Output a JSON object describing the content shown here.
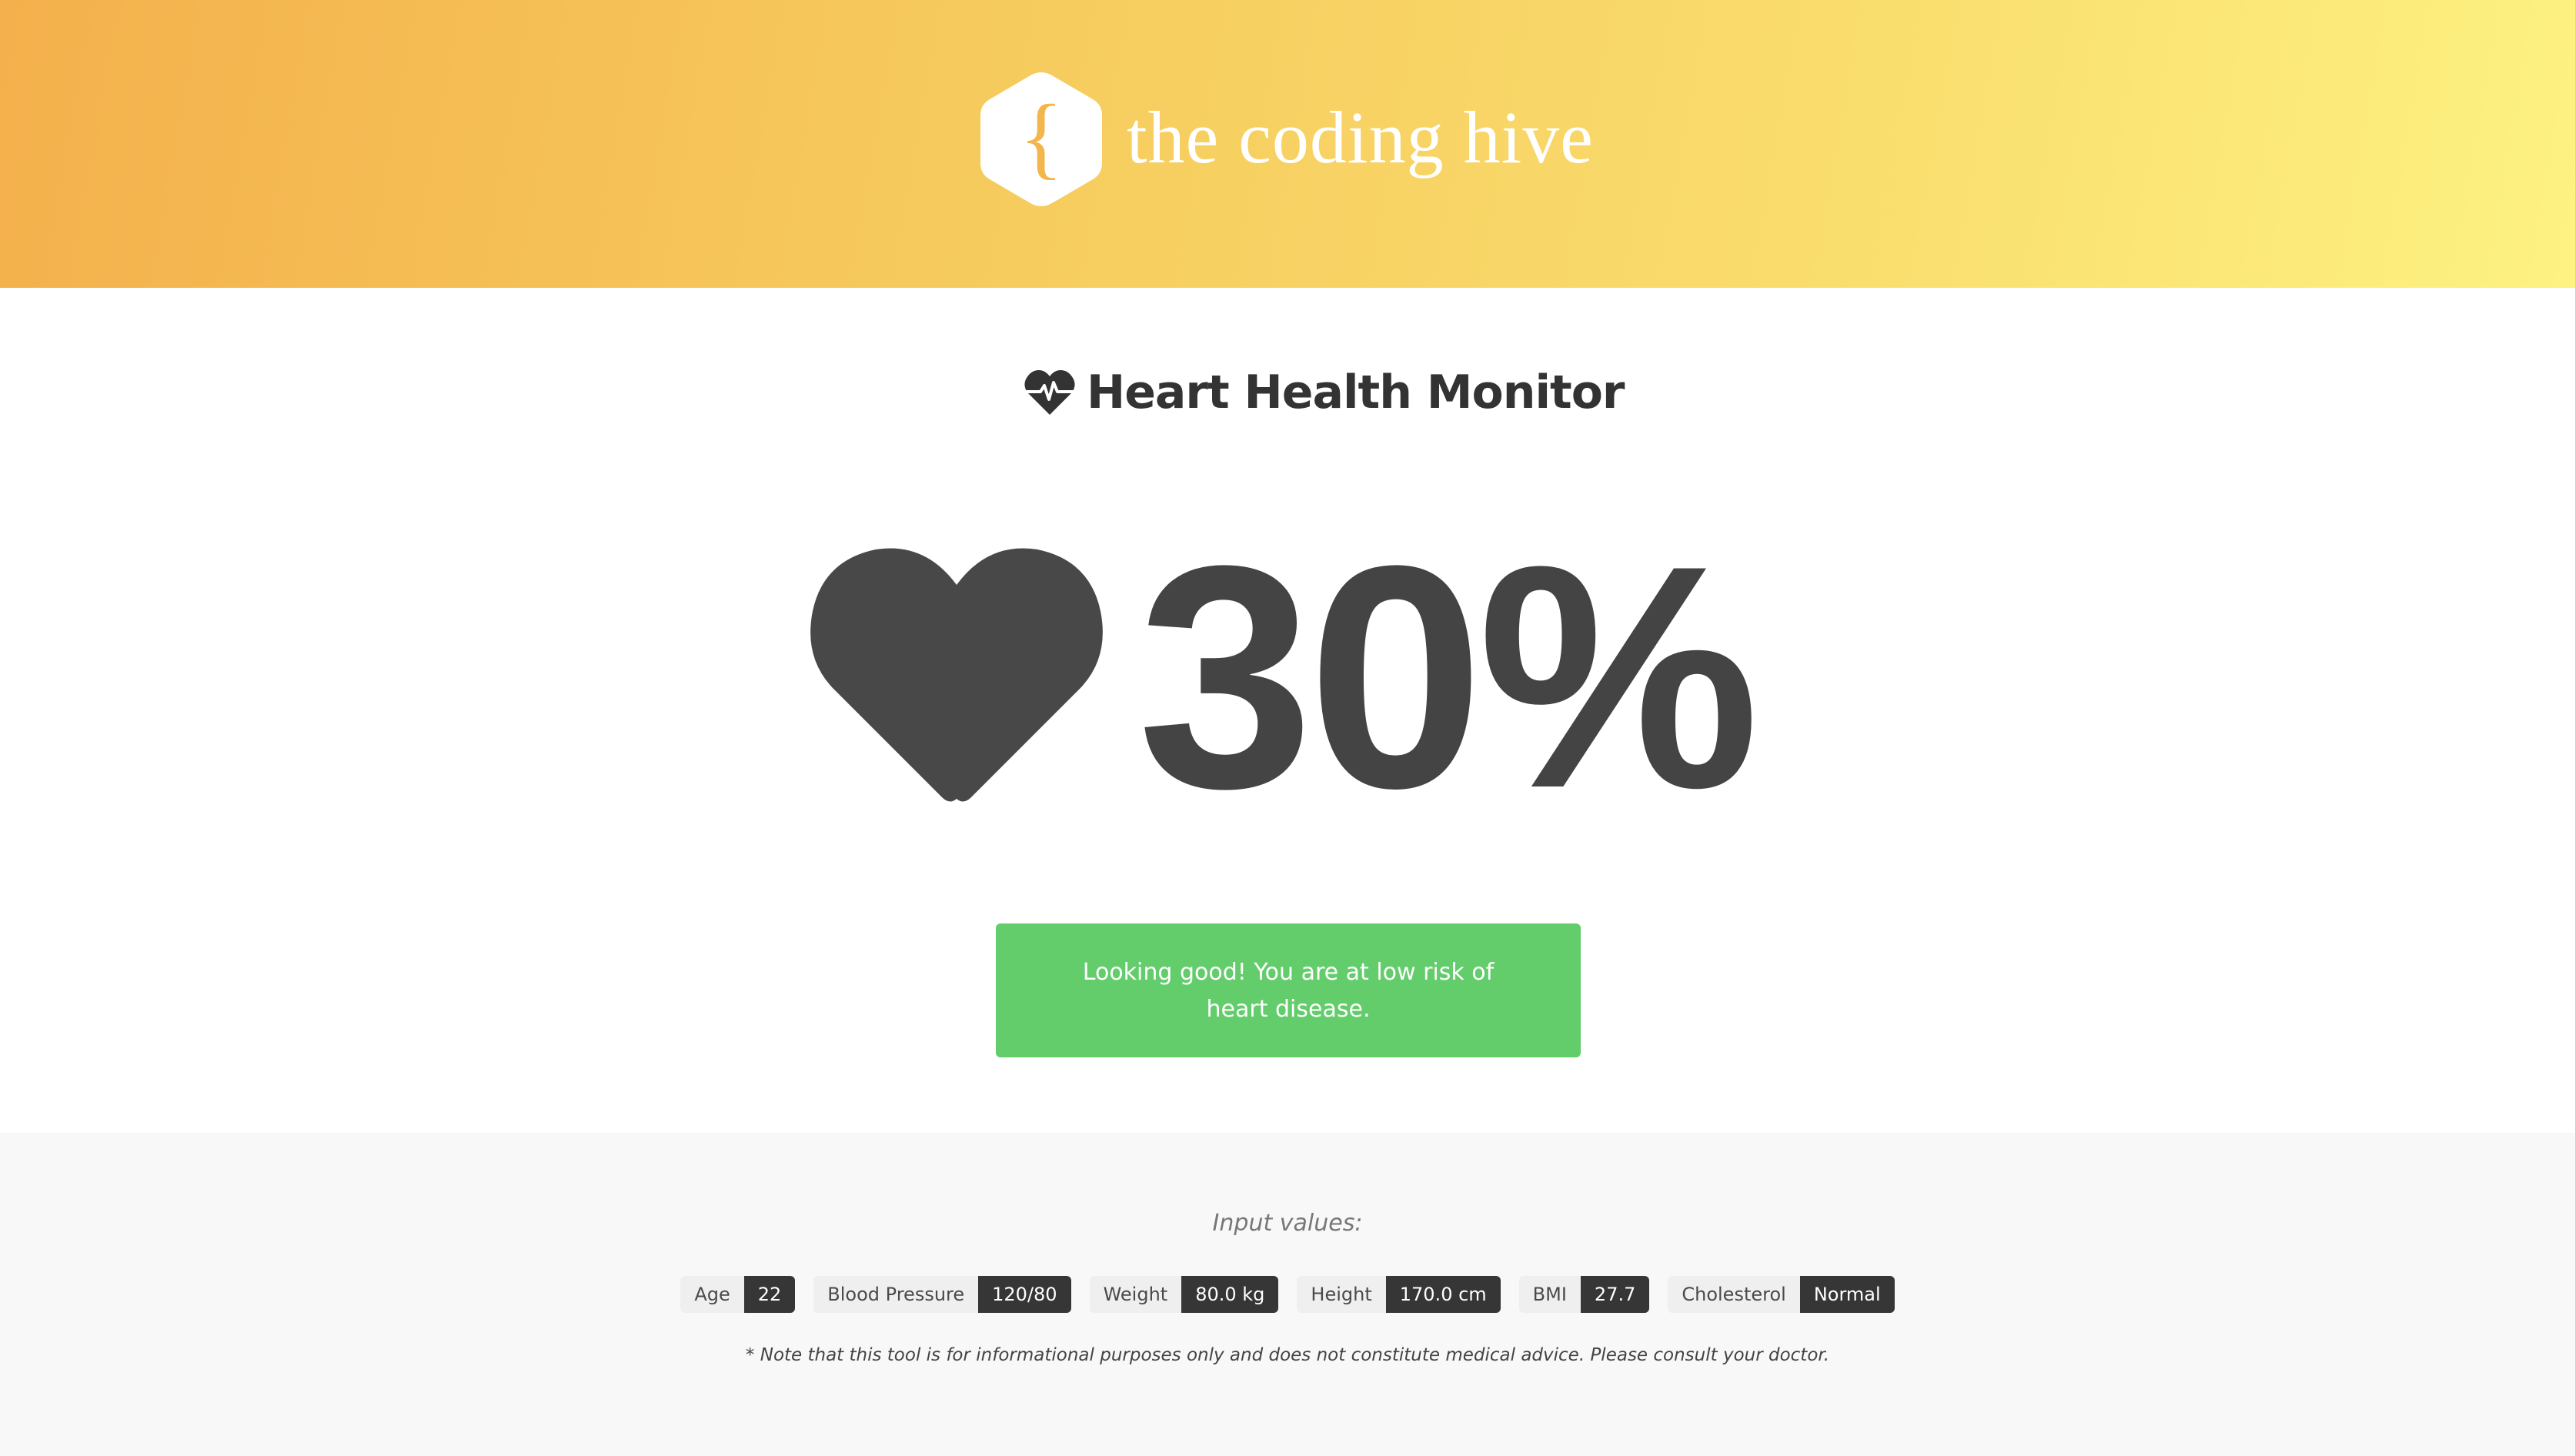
{
  "header": {
    "brand_name": "the coding hive",
    "logo_icon": "hexagon-brace-logo",
    "logo_glyph": "{",
    "gradient_colors": [
      "#f4b04c",
      "#fdf282"
    ]
  },
  "main": {
    "title": "Heart Health Monitor",
    "title_icon": "heartbeat-icon",
    "score_icon": "heart-icon",
    "risk_value": "30%",
    "alert": {
      "text": "Looking good! You are at low risk of heart disease.",
      "color": "#63cd6c"
    }
  },
  "footer": {
    "heading": "Input values:",
    "inputs": [
      {
        "label": "Age",
        "value": "22"
      },
      {
        "label": "Blood Pressure",
        "value": "120/80"
      },
      {
        "label": "Weight",
        "value": "80.0 kg"
      },
      {
        "label": "Height",
        "value": "170.0 cm"
      },
      {
        "label": "BMI",
        "value": "27.7"
      },
      {
        "label": "Cholesterol",
        "value": "Normal"
      }
    ],
    "disclaimer": "* Note that this tool is for informational purposes only and does not constitute medical advice. Please consult your doctor."
  }
}
